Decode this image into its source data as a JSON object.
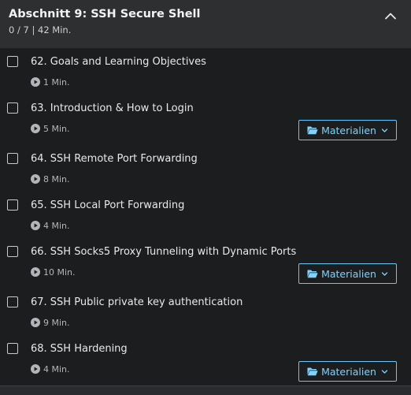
{
  "section": {
    "title": "Abschnitt 9: SSH Secure Shell",
    "meta": "0 / 7 | 42 Min."
  },
  "materials_label": "Materialien",
  "lectures": [
    {
      "title": "62. Goals and Learning Objectives",
      "duration": "1 Min.",
      "has_materials": false
    },
    {
      "title": "63. Introduction & How to Login",
      "duration": "5 Min.",
      "has_materials": true
    },
    {
      "title": "64. SSH Remote Port Forwarding",
      "duration": "8 Min.",
      "has_materials": false
    },
    {
      "title": "65. SSH Local Port Forwarding",
      "duration": "4 Min.",
      "has_materials": false
    },
    {
      "title": "66. SSH Socks5 Proxy Tunneling with Dynamic Ports",
      "duration": "10 Min.",
      "has_materials": true
    },
    {
      "title": "67. SSH Public private key authentication",
      "duration": "9 Min.",
      "has_materials": false
    },
    {
      "title": "68. SSH Hardening",
      "duration": "4 Min.",
      "has_materials": true
    }
  ],
  "colors": {
    "background": "#1c1d1f",
    "header": "#2d2f31",
    "accent": "#7fd3ff"
  }
}
